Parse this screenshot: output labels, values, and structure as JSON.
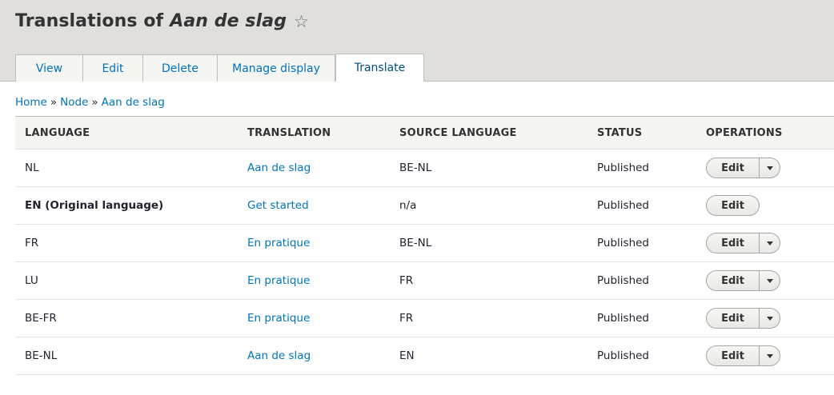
{
  "page": {
    "title_prefix": "Translations of",
    "title_node": "Aan de slag",
    "star_glyph": "☆"
  },
  "tabs": [
    {
      "label": "View",
      "active": false
    },
    {
      "label": "Edit",
      "active": false
    },
    {
      "label": "Delete",
      "active": false
    },
    {
      "label": "Manage display",
      "active": false
    },
    {
      "label": "Translate",
      "active": true
    }
  ],
  "breadcrumb": {
    "items": [
      "Home",
      "Node",
      "Aan de slag"
    ],
    "separator": "»"
  },
  "table": {
    "headers": [
      "LANGUAGE",
      "TRANSLATION",
      "SOURCE LANGUAGE",
      "STATUS",
      "OPERATIONS"
    ],
    "rows": [
      {
        "language": "NL",
        "translation": "Aan de slag",
        "source": "BE-NL",
        "status": "Published",
        "op_label": "Edit",
        "has_dropdown": true
      },
      {
        "language": "EN (Original language)",
        "translation": "Get started",
        "source": "n/a",
        "status": "Published",
        "op_label": "Edit",
        "has_dropdown": false
      },
      {
        "language": "FR",
        "translation": "En pratique",
        "source": "BE-NL",
        "status": "Published",
        "op_label": "Edit",
        "has_dropdown": true
      },
      {
        "language": "LU",
        "translation": "En pratique",
        "source": "FR",
        "status": "Published",
        "op_label": "Edit",
        "has_dropdown": true
      },
      {
        "language": "BE-FR",
        "translation": "En pratique",
        "source": "FR",
        "status": "Published",
        "op_label": "Edit",
        "has_dropdown": true
      },
      {
        "language": "BE-NL",
        "translation": "Aan de slag",
        "source": "EN",
        "status": "Published",
        "op_label": "Edit",
        "has_dropdown": true
      }
    ]
  },
  "colors": {
    "header_bg": "#e0dfdb",
    "link": "#0074bd",
    "tab_bg": "#f5f5f2"
  }
}
